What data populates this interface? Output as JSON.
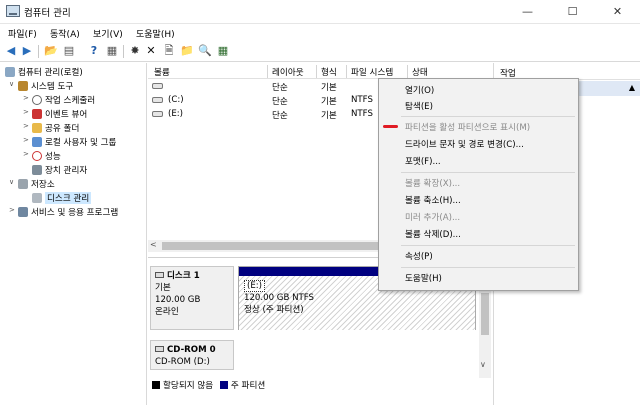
{
  "window": {
    "title": "컴퓨터 관리"
  },
  "menubar": [
    "파일(F)",
    "동작(A)",
    "보기(V)",
    "도움말(H)"
  ],
  "tree": {
    "root": "컴퓨터 관리(로컬)",
    "system_tools": "시스템 도구",
    "task_scheduler": "작업 스케줄러",
    "event_viewer": "이벤트 뷰어",
    "shared_folders": "공유 폴더",
    "local_users": "로컬 사용자 및 그룹",
    "performance": "성능",
    "device_manager": "장치 관리자",
    "storage": "저장소",
    "disk_management": "디스크 관리",
    "services_apps": "서비스 및 응용 프로그램"
  },
  "volume_list": {
    "columns": [
      "볼륨",
      "레이아웃",
      "형식",
      "파일 시스템",
      "상태"
    ],
    "rows": [
      {
        "volume": "",
        "layout": "단순",
        "type": "기본",
        "fs": ""
      },
      {
        "volume": "(C:)",
        "layout": "단순",
        "type": "기본",
        "fs": "NTFS"
      },
      {
        "volume": "(E:)",
        "layout": "단순",
        "type": "기본",
        "fs": "NTFS"
      }
    ]
  },
  "disks": {
    "disk1": {
      "name": "디스크 1",
      "type": "기본",
      "size": "120.00 GB",
      "status": "온라인"
    },
    "disk1_partition": {
      "label": "(E:)",
      "size_fs": "120.00 GB NTFS",
      "status": "정상 (주 파티션)"
    },
    "cdrom": {
      "name": "CD-ROM 0",
      "drive": "CD-ROM (D:)"
    }
  },
  "legend": {
    "unallocated": "할당되지 않음",
    "primary": "주 파티션"
  },
  "actions": {
    "header": "작업"
  },
  "context_menu": {
    "open": "열기(O)",
    "explore": "탐색(E)",
    "mark_active": "파티션을 활성 파티션으로 표시(M)",
    "change_letter": "드라이브 문자 및 경로 변경(C)...",
    "format": "포맷(F)...",
    "extend": "볼륨 확장(X)...",
    "shrink": "볼륨 축소(H)...",
    "add_mirror": "미러 추가(A)...",
    "delete": "볼륨 삭제(D)...",
    "properties": "속성(P)",
    "help": "도움말(H)"
  },
  "colors": {
    "primary_partition": "#000080",
    "unallocated": "#000000",
    "highlight_marker": "#e01b24"
  }
}
